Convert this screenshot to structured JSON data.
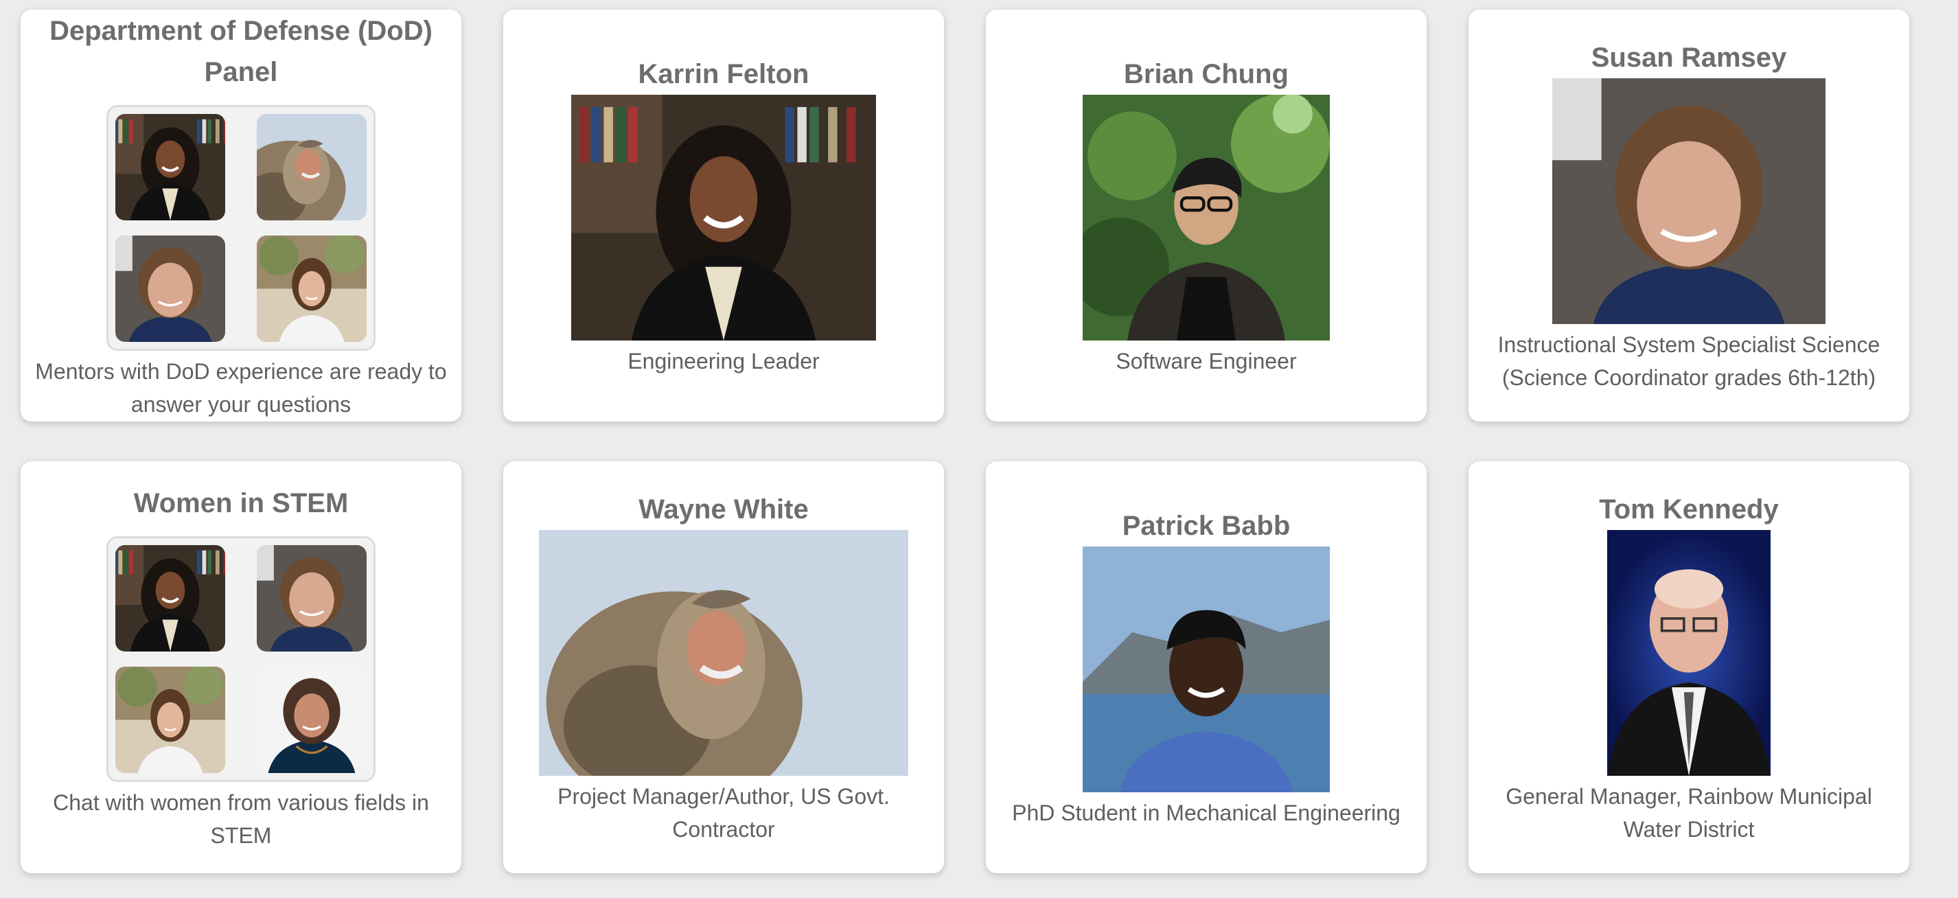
{
  "cards": [
    {
      "name": "Department of Defense (DoD) Panel",
      "desc": "Mentors with DoD experience are ready to answer your questions"
    },
    {
      "name": "Karrin Felton",
      "role": "Engineering Leader"
    },
    {
      "name": "Brian Chung",
      "role": "Software Engineer"
    },
    {
      "name": "Susan Ramsey",
      "role": "Instructional System Specialist Science (Science Coordinator grades 6th-12th)"
    },
    {
      "name": "Women in STEM",
      "desc": "Chat with women from various fields in STEM"
    },
    {
      "name": "Wayne White",
      "role": "Project Manager/Author, US Govt. Contractor"
    },
    {
      "name": "Patrick Babb",
      "role": "PhD Student in Mechanical Engineering"
    },
    {
      "name": "Tom Kennedy",
      "role": "General Manager, Rainbow Municipal Water District"
    }
  ]
}
